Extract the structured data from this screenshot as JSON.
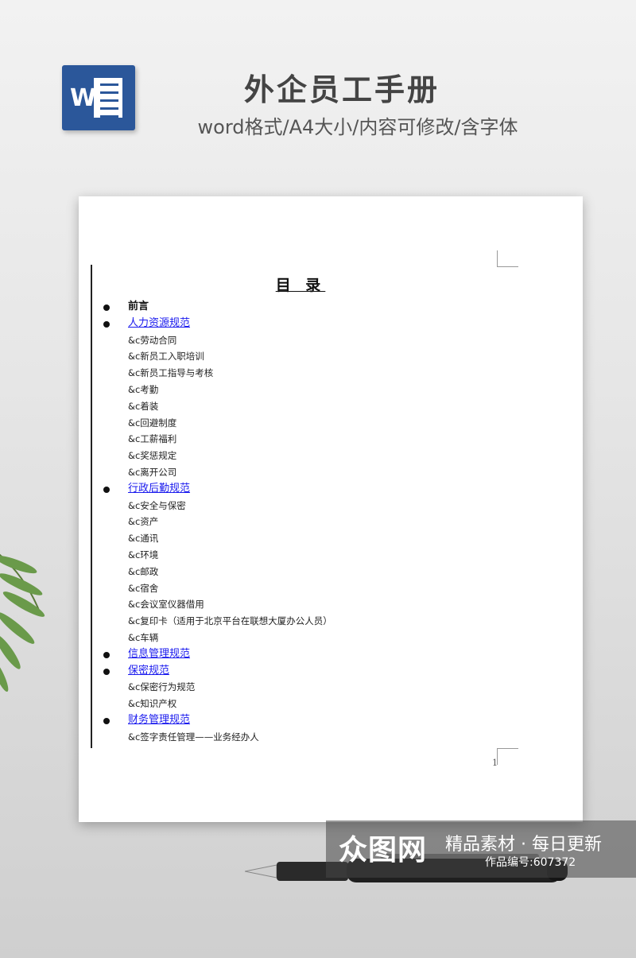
{
  "header": {
    "icon_letter": "W",
    "title": "外企员工手册",
    "subtitle": "word格式/A4大小/内容可修改/含字体"
  },
  "document": {
    "toc_title": "目 录",
    "page_number": "1",
    "items": [
      {
        "kind": "bullet",
        "style": "plain",
        "text": "前言"
      },
      {
        "kind": "bullet",
        "style": "link",
        "text": "人力资源规范"
      },
      {
        "kind": "sub",
        "text": "&c劳动合同"
      },
      {
        "kind": "sub",
        "text": "&c新员工入职培训"
      },
      {
        "kind": "sub",
        "text": "&c新员工指导与考核"
      },
      {
        "kind": "sub",
        "text": "&c考勤"
      },
      {
        "kind": "sub",
        "text": "&c着装"
      },
      {
        "kind": "sub",
        "text": "&c回避制度"
      },
      {
        "kind": "sub",
        "text": "&c工薪福利"
      },
      {
        "kind": "sub",
        "text": "&c奖惩规定"
      },
      {
        "kind": "sub",
        "text": "&c离开公司"
      },
      {
        "kind": "bullet",
        "style": "link",
        "text": "行政后勤规范"
      },
      {
        "kind": "sub",
        "text": "&c安全与保密"
      },
      {
        "kind": "sub",
        "text": "&c资产"
      },
      {
        "kind": "sub",
        "text": "&c通讯"
      },
      {
        "kind": "sub",
        "text": "&c环境"
      },
      {
        "kind": "sub",
        "text": "&c邮政"
      },
      {
        "kind": "sub",
        "text": "&c宿舍"
      },
      {
        "kind": "sub",
        "text": "&c会议室仪器借用"
      },
      {
        "kind": "sub",
        "text": "&c复印卡（适用于北京平台在联想大厦办公人员）"
      },
      {
        "kind": "sub",
        "text": "&c车辆"
      },
      {
        "kind": "bullet",
        "style": "link",
        "text": "信息管理规范"
      },
      {
        "kind": "bullet",
        "style": "link",
        "text": "保密规范"
      },
      {
        "kind": "sub",
        "text": "&c保密行为规范"
      },
      {
        "kind": "sub",
        "text": "&c知识产权"
      },
      {
        "kind": "bullet",
        "style": "link",
        "text": "财务管理规范"
      },
      {
        "kind": "sub",
        "text": "&c签字责任管理——业务经办人"
      }
    ]
  },
  "watermark": {
    "brand": "众图网",
    "slogan": "精品素材 · 每日更新",
    "code": "作品编号:607372"
  },
  "colors": {
    "word_blue": "#2b579a",
    "link_blue": "#1a1aee"
  }
}
